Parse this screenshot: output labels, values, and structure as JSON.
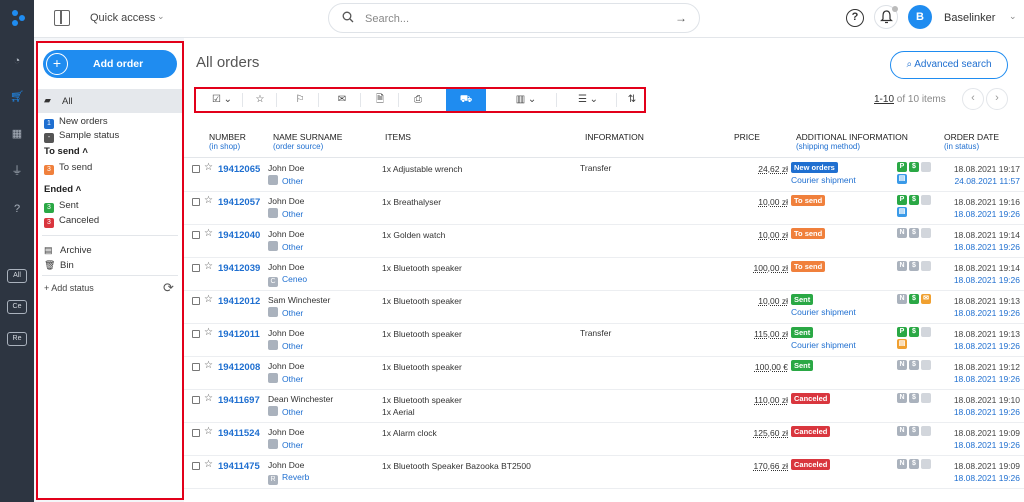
{
  "topbar": {
    "quick_access": "Quick access",
    "search_placeholder": "Search...",
    "user_initial": "B",
    "user_name": "Baselinker"
  },
  "rail": {
    "tags": [
      "All",
      "Ce",
      "Re"
    ]
  },
  "sidebar": {
    "add_order": "Add order",
    "all": "All",
    "statuses": [
      {
        "label": "New orders",
        "count": "1",
        "color": "#1f6fd0"
      },
      {
        "label": "Sample status",
        "count": "-",
        "color": "#555555"
      }
    ],
    "group_to_send": "To send",
    "to_send_items": [
      {
        "label": "To send",
        "count": "3",
        "color": "#f0803c"
      }
    ],
    "group_ended": "Ended",
    "ended_items": [
      {
        "label": "Sent",
        "count": "3",
        "color": "#2aa845"
      },
      {
        "label": "Canceled",
        "count": "3",
        "color": "#d9363e"
      }
    ],
    "archive": "Archive",
    "bin": "Bin",
    "add_status": "+ Add status"
  },
  "main": {
    "title": "All orders",
    "advanced_search": "Advanced search",
    "pager_range": "1-10",
    "pager_rest": " of 10 items"
  },
  "table": {
    "headers": {
      "number": "NUMBER",
      "number_sub": "(in shop)",
      "name": "NAME SURNAME",
      "name_sub": "(order source)",
      "items": "ITEMS",
      "information": "INFORMATION",
      "price": "PRICE",
      "additional": "ADDITIONAL INFORMATION",
      "additional_sub": "(shipping method)",
      "date": "ORDER DATE",
      "date_sub": "(in status)"
    },
    "rows": [
      {
        "number": "19412065",
        "name": "John Doe",
        "source": "Other",
        "src_icon": "",
        "items": [
          "1x Adjustable wrench"
        ],
        "info": "Transfer",
        "price": "24,62 zł",
        "status": "New orders",
        "status_color": "#1f6fd0",
        "shipping": "Courier shipment",
        "date": "18.08.2021 19:17",
        "date_status": "24.08.2021 11:57"
      },
      {
        "number": "19412057",
        "name": "John Doe",
        "source": "Other",
        "src_icon": "",
        "items": [
          "1x Breathalyser"
        ],
        "info": "",
        "price": "10,00 zł",
        "status": "To send",
        "status_color": "#f0803c",
        "shipping": "",
        "date": "18.08.2021 19:16",
        "date_status": "18.08.2021 19:26"
      },
      {
        "number": "19412040",
        "name": "John Doe",
        "source": "Other",
        "src_icon": "",
        "items": [
          "1x Golden watch"
        ],
        "info": "",
        "price": "10,00 zł",
        "status": "To send",
        "status_color": "#f0803c",
        "shipping": "",
        "date": "18.08.2021 19:14",
        "date_status": "18.08.2021 19:26"
      },
      {
        "number": "19412039",
        "name": "John Doe",
        "source": "Ceneo",
        "src_icon": "C",
        "items": [
          "1x Bluetooth speaker"
        ],
        "info": "",
        "price": "100,00 zł",
        "status": "To send",
        "status_color": "#f0803c",
        "shipping": "",
        "date": "18.08.2021 19:14",
        "date_status": "18.08.2021 19:26"
      },
      {
        "number": "19412012",
        "name": "Sam Winchester",
        "source": "Other",
        "src_icon": "",
        "items": [
          "1x Bluetooth speaker"
        ],
        "info": "",
        "price": "10,00 zł",
        "status": "Sent",
        "status_color": "#2aa845",
        "shipping": "Courier shipment",
        "date": "18.08.2021 19:13",
        "date_status": "18.08.2021 19:26"
      },
      {
        "number": "19412011",
        "name": "John Doe",
        "source": "Other",
        "src_icon": "",
        "items": [
          "1x Bluetooth speaker"
        ],
        "info": "Transfer",
        "price": "115,00 zł",
        "status": "Sent",
        "status_color": "#2aa845",
        "shipping": "Courier shipment",
        "date": "18.08.2021 19:13",
        "date_status": "18.08.2021 19:26"
      },
      {
        "number": "19412008",
        "name": "John Doe",
        "source": "Other",
        "src_icon": "",
        "items": [
          "1x Bluetooth speaker"
        ],
        "info": "",
        "price": "100,00 €",
        "status": "Sent",
        "status_color": "#2aa845",
        "shipping": "",
        "date": "18.08.2021 19:12",
        "date_status": "18.08.2021 19:26"
      },
      {
        "number": "19411697",
        "name": "Dean Winchester",
        "source": "Other",
        "src_icon": "",
        "items": [
          "1x Bluetooth speaker",
          "1x Aerial"
        ],
        "info": "",
        "price": "110,00 zł",
        "status": "Canceled",
        "status_color": "#d9363e",
        "shipping": "",
        "date": "18.08.2021 19:10",
        "date_status": "18.08.2021 19:26"
      },
      {
        "number": "19411524",
        "name": "John Doe",
        "source": "Other",
        "src_icon": "",
        "items": [
          "1x Alarm clock"
        ],
        "info": "",
        "price": "125,60 zł",
        "status": "Canceled",
        "status_color": "#d9363e",
        "shipping": "",
        "date": "18.08.2021 19:09",
        "date_status": "18.08.2021 19:26"
      },
      {
        "number": "19411475",
        "name": "John Doe",
        "source": "Reverb",
        "src_icon": "R",
        "items": [
          "1x Bluetooth Speaker Bazooka BT2500"
        ],
        "info": "",
        "price": "170,66 zł",
        "status": "Canceled",
        "status_color": "#d9363e",
        "shipping": "",
        "date": "18.08.2021 19:09",
        "date_status": "18.08.2021 19:26"
      }
    ],
    "flags": [
      [
        "P",
        "$",
        "doc-blue"
      ],
      [
        "P",
        "$",
        "doc-blue"
      ],
      [
        "N",
        "$",
        "doc-grey"
      ],
      [
        "N",
        "$",
        "doc-grey"
      ],
      [
        "N",
        "$",
        "mail-orange"
      ],
      [
        "P",
        "$",
        "doc-orange"
      ],
      [
        "N",
        "$",
        "doc-grey"
      ],
      [
        "N",
        "$",
        "doc-grey"
      ],
      [
        "N",
        "$",
        "doc-grey"
      ],
      [
        "N",
        "$",
        "doc-grey"
      ]
    ]
  }
}
